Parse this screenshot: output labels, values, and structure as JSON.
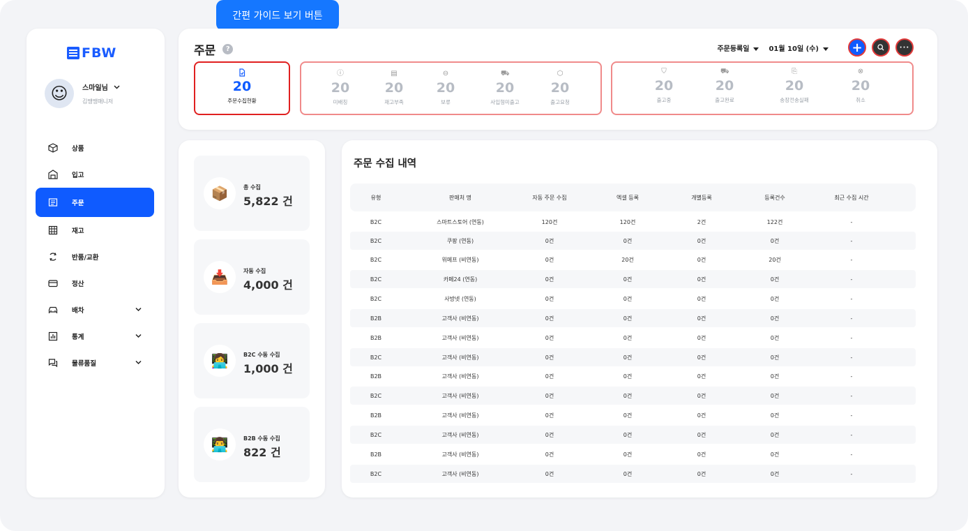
{
  "tooltip": "간편 가이드 보기 버튼",
  "logo": "FBW",
  "profile": {
    "name": "스마일님",
    "role": "김땡땡매니저",
    "avatar": "smiling-face"
  },
  "menu": [
    {
      "label": "상품",
      "icon": "box-icon",
      "active": false,
      "expandable": false
    },
    {
      "label": "입고",
      "icon": "warehouse-icon",
      "active": false,
      "expandable": false
    },
    {
      "label": "주문",
      "icon": "order-icon",
      "active": true,
      "expandable": false
    },
    {
      "label": "재고",
      "icon": "grid-icon",
      "active": false,
      "expandable": false
    },
    {
      "label": "반품/교환",
      "icon": "exchange-icon",
      "active": false,
      "expandable": false
    },
    {
      "label": "정산",
      "icon": "card-icon",
      "active": false,
      "expandable": false
    },
    {
      "label": "배차",
      "icon": "car-icon",
      "active": false,
      "expandable": true
    },
    {
      "label": "통계",
      "icon": "chart-icon",
      "active": false,
      "expandable": true
    },
    {
      "label": "물류품질",
      "icon": "chat-icon",
      "active": false,
      "expandable": true
    }
  ],
  "header": {
    "title": "주문",
    "help": "?",
    "filter_date_type": "주문등록일",
    "filter_date": "01월 10일 (수)"
  },
  "stats": {
    "primary": {
      "value": "20",
      "label": "주문수집현황"
    },
    "group1": [
      {
        "value": "20",
        "label": "미배칭",
        "icon": "alert-icon"
      },
      {
        "value": "20",
        "label": "재고부족",
        "icon": "stock-icon"
      },
      {
        "value": "20",
        "label": "보류",
        "icon": "minus-circle-icon"
      },
      {
        "value": "20",
        "label": "사입형미출고",
        "icon": "truck-box-icon"
      },
      {
        "value": "20",
        "label": "출고요청",
        "icon": "package-icon"
      }
    ],
    "group2": [
      {
        "value": "20",
        "label": "출고중",
        "icon": "shipping-icon"
      },
      {
        "value": "20",
        "label": "출고완료",
        "icon": "truck-icon"
      },
      {
        "value": "20",
        "label": "송장전송실패",
        "icon": "document-icon"
      },
      {
        "value": "20",
        "label": "취소",
        "icon": "x-circle-icon"
      }
    ]
  },
  "summary": [
    {
      "label": "총 수집",
      "value": "5,822 건",
      "icon": "box-emoji"
    },
    {
      "label": "자동 수집",
      "value": "4,000 건",
      "icon": "auto-emoji"
    },
    {
      "label": "B2C 수동 수집",
      "value": "1,000 건",
      "icon": "person-emoji"
    },
    {
      "label": "B2B 수동 수집",
      "value": "822 건",
      "icon": "person-emoji"
    }
  ],
  "table": {
    "title": "주문 수집 내역",
    "columns": [
      "유형",
      "판매처 명",
      "자동 주문 수집",
      "엑셀 등록",
      "개별등록",
      "등록건수",
      "최근 수집 시간"
    ],
    "rows": [
      [
        "B2C",
        "스마트스토어 (연동)",
        "120건",
        "120건",
        "2건",
        "122건",
        "-"
      ],
      [
        "B2C",
        "쿠팡 (연동)",
        "0건",
        "0건",
        "0건",
        "0건",
        "-"
      ],
      [
        "B2C",
        "위메프 (비연동)",
        "0건",
        "20건",
        "0건",
        "20건",
        "-"
      ],
      [
        "B2C",
        "카페24 (연동)",
        "0건",
        "0건",
        "0건",
        "0건",
        "-"
      ],
      [
        "B2C",
        "사방넷 (연동)",
        "0건",
        "0건",
        "0건",
        "0건",
        "-"
      ],
      [
        "B2B",
        "고객사 (비연동)",
        "0건",
        "0건",
        "0건",
        "0건",
        "-"
      ],
      [
        "B2B",
        "고객사 (비연동)",
        "0건",
        "0건",
        "0건",
        "0건",
        "-"
      ],
      [
        "B2C",
        "고객사 (비연동)",
        "0건",
        "0건",
        "0건",
        "0건",
        "-"
      ],
      [
        "B2B",
        "고객사 (비연동)",
        "0건",
        "0건",
        "0건",
        "0건",
        "-"
      ],
      [
        "B2C",
        "고객사 (비연동)",
        "0건",
        "0건",
        "0건",
        "0건",
        "-"
      ],
      [
        "B2B",
        "고객사 (비연동)",
        "0건",
        "0건",
        "0건",
        "0건",
        "-"
      ],
      [
        "B2C",
        "고객사 (비연동)",
        "0건",
        "0건",
        "0건",
        "0건",
        "-"
      ],
      [
        "B2B",
        "고객사 (비연동)",
        "0건",
        "0건",
        "0건",
        "0건",
        "-"
      ],
      [
        "B2C",
        "고객사 (비연동)",
        "0건",
        "0건",
        "0건",
        "0건",
        "-"
      ]
    ]
  },
  "colors": {
    "accent": "#0f5bff",
    "tooltip": "#1577ff",
    "highlight_border": "#e02020"
  }
}
